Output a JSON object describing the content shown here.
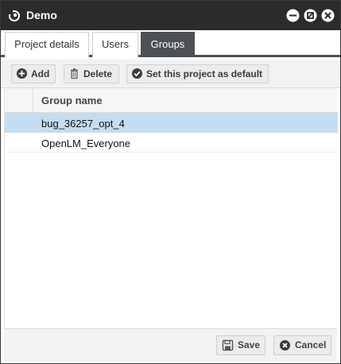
{
  "window": {
    "title": "Demo",
    "icon": "app-swirl-icon"
  },
  "tabs": [
    {
      "label": "Project details",
      "active": false
    },
    {
      "label": "Users",
      "active": false
    },
    {
      "label": "Groups",
      "active": true
    }
  ],
  "toolbar": {
    "add_label": "Add",
    "delete_label": "Delete",
    "default_label": "Set this project as default"
  },
  "grid": {
    "column_header": "Group name",
    "rows": [
      {
        "name": "bug_36257_opt_4",
        "selected": true
      },
      {
        "name": "OpenLM_Everyone",
        "selected": false
      }
    ]
  },
  "footer": {
    "save_label": "Save",
    "cancel_label": "Cancel"
  },
  "colors": {
    "titlebar": "#2b2b2b",
    "active_tab": "#4d5154",
    "selected_row": "#c4ddf0"
  }
}
